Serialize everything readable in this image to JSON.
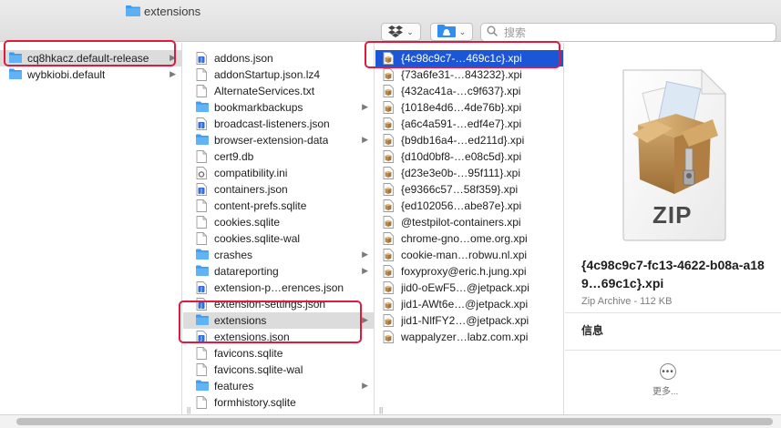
{
  "window": {
    "title": "extensions"
  },
  "toolbar": {
    "dropbox_icon": "dropbox-icon",
    "share_icon": "folder-share-icon",
    "search_placeholder": "搜索"
  },
  "colors": {
    "selection_blue": "#1a56d6",
    "highlight_red": "#e2193f",
    "folder_blue": "#3d9bf0"
  },
  "column1": {
    "items": [
      {
        "label": "cq8hkacz.default-release",
        "type": "folder",
        "selected": true
      },
      {
        "label": "wybkiobi.default",
        "type": "folder"
      }
    ]
  },
  "column2": {
    "items": [
      {
        "label": "addons.json",
        "type": "json"
      },
      {
        "label": "addonStartup.json.lz4",
        "type": "file"
      },
      {
        "label": "AlternateServices.txt",
        "type": "file"
      },
      {
        "label": "bookmarkbackups",
        "type": "folder"
      },
      {
        "label": "broadcast-listeners.json",
        "type": "json"
      },
      {
        "label": "browser-extension-data",
        "type": "folder"
      },
      {
        "label": "cert9.db",
        "type": "file"
      },
      {
        "label": "compatibility.ini",
        "type": "ini"
      },
      {
        "label": "containers.json",
        "type": "json"
      },
      {
        "label": "content-prefs.sqlite",
        "type": "file"
      },
      {
        "label": "cookies.sqlite",
        "type": "file"
      },
      {
        "label": "cookies.sqlite-wal",
        "type": "file"
      },
      {
        "label": "crashes",
        "type": "folder"
      },
      {
        "label": "datareporting",
        "type": "folder"
      },
      {
        "label": "extension-p…erences.json",
        "type": "json"
      },
      {
        "label": "extension-settings.json",
        "type": "json"
      },
      {
        "label": "extensions",
        "type": "folder",
        "selected": true
      },
      {
        "label": "extensions.json",
        "type": "json"
      },
      {
        "label": "favicons.sqlite",
        "type": "file"
      },
      {
        "label": "favicons.sqlite-wal",
        "type": "file"
      },
      {
        "label": "features",
        "type": "folder"
      },
      {
        "label": "formhistory.sqlite",
        "type": "file"
      }
    ]
  },
  "column3": {
    "items": [
      {
        "label": "{4c98c9c7-…469c1c}.xpi",
        "selected": true
      },
      {
        "label": "{73a6fe31-…843232}.xpi"
      },
      {
        "label": "{432ac41a-…c9f637}.xpi"
      },
      {
        "label": "{1018e4d6…4de76b}.xpi"
      },
      {
        "label": "{a6c4a591-…edf4e7}.xpi"
      },
      {
        "label": "{b9db16a4-…ed211d}.xpi"
      },
      {
        "label": "{d10d0bf8-…e08c5d}.xpi"
      },
      {
        "label": "{d23e3e0b-…95f111}.xpi"
      },
      {
        "label": "{e9366c57…58f359}.xpi"
      },
      {
        "label": "{ed102056…abe87e}.xpi"
      },
      {
        "label": "@testpilot-containers.xpi"
      },
      {
        "label": "chrome-gno…ome.org.xpi"
      },
      {
        "label": "cookie-man…robwu.nl.xpi"
      },
      {
        "label": "foxyproxy@eric.h.jung.xpi"
      },
      {
        "label": "jid0-oEwF5…@jetpack.xpi"
      },
      {
        "label": "jid1-AWt6e…@jetpack.xpi"
      },
      {
        "label": "jid1-NlfFY2…@jetpack.xpi"
      },
      {
        "label": "wappalyzer…labz.com.xpi"
      }
    ]
  },
  "preview": {
    "zip_label": "ZIP",
    "file_name": "{4c98c9c7-fc13-4622-b08a-a189…69c1c}.xpi",
    "kind": "Zip Archive - 112 KB",
    "info_heading": "信息",
    "more_label": "更多..."
  }
}
